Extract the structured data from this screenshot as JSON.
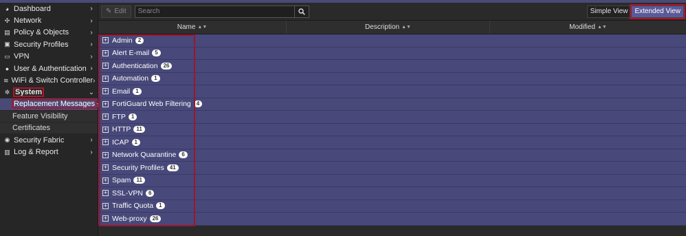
{
  "sidebar": {
    "items": [
      {
        "label": "Dashboard",
        "icon": "dashboard-icon",
        "glyph": "◕",
        "chevron": "›"
      },
      {
        "label": "Network",
        "icon": "network-icon",
        "glyph": "✣",
        "chevron": "›"
      },
      {
        "label": "Policy & Objects",
        "icon": "policy-icon",
        "glyph": "▤",
        "chevron": "›"
      },
      {
        "label": "Security Profiles",
        "icon": "lock-icon",
        "glyph": "▣",
        "chevron": "›"
      },
      {
        "label": "VPN",
        "icon": "vpn-icon",
        "glyph": "▭",
        "chevron": "›"
      },
      {
        "label": "User & Authentication",
        "icon": "user-icon",
        "glyph": "●",
        "chevron": "›"
      },
      {
        "label": "WiFi & Switch Controller",
        "icon": "wifi-icon",
        "glyph": "≋",
        "chevron": "›"
      },
      {
        "label": "System",
        "icon": "gear-icon",
        "glyph": "✲",
        "chevron": "⌄"
      }
    ],
    "system_sub": [
      {
        "label": "Replacement Messages",
        "star": "☆"
      },
      {
        "label": "Feature Visibility"
      },
      {
        "label": "Certificates"
      }
    ],
    "items_after": [
      {
        "label": "Security Fabric",
        "icon": "fabric-icon",
        "glyph": "◉",
        "chevron": "›"
      },
      {
        "label": "Log & Report",
        "icon": "report-icon",
        "glyph": "▥",
        "chevron": "›"
      }
    ]
  },
  "toolbar": {
    "edit_label": "Edit",
    "search_placeholder": "Search",
    "simple_view": "Simple View",
    "extended_view": "Extended View"
  },
  "table": {
    "columns": [
      "Name",
      "Description",
      "Modified"
    ],
    "rows": [
      {
        "name": "Admin",
        "count": "2"
      },
      {
        "name": "Alert E-mail",
        "count": "5"
      },
      {
        "name": "Authentication",
        "count": "26"
      },
      {
        "name": "Automation",
        "count": "1"
      },
      {
        "name": "Email",
        "count": "1"
      },
      {
        "name": "FortiGuard Web Filtering",
        "count": "4"
      },
      {
        "name": "FTP",
        "count": "1"
      },
      {
        "name": "HTTP",
        "count": "11"
      },
      {
        "name": "ICAP",
        "count": "1"
      },
      {
        "name": "Network Quarantine",
        "count": "6"
      },
      {
        "name": "Security Profiles",
        "count": "41"
      },
      {
        "name": "Spam",
        "count": "11"
      },
      {
        "name": "SSL-VPN",
        "count": "6"
      },
      {
        "name": "Traffic Quota",
        "count": "1"
      },
      {
        "name": "Web-proxy",
        "count": "26"
      }
    ]
  },
  "colors": {
    "accent": "#4a4a77",
    "highlight": "#b0142a"
  }
}
